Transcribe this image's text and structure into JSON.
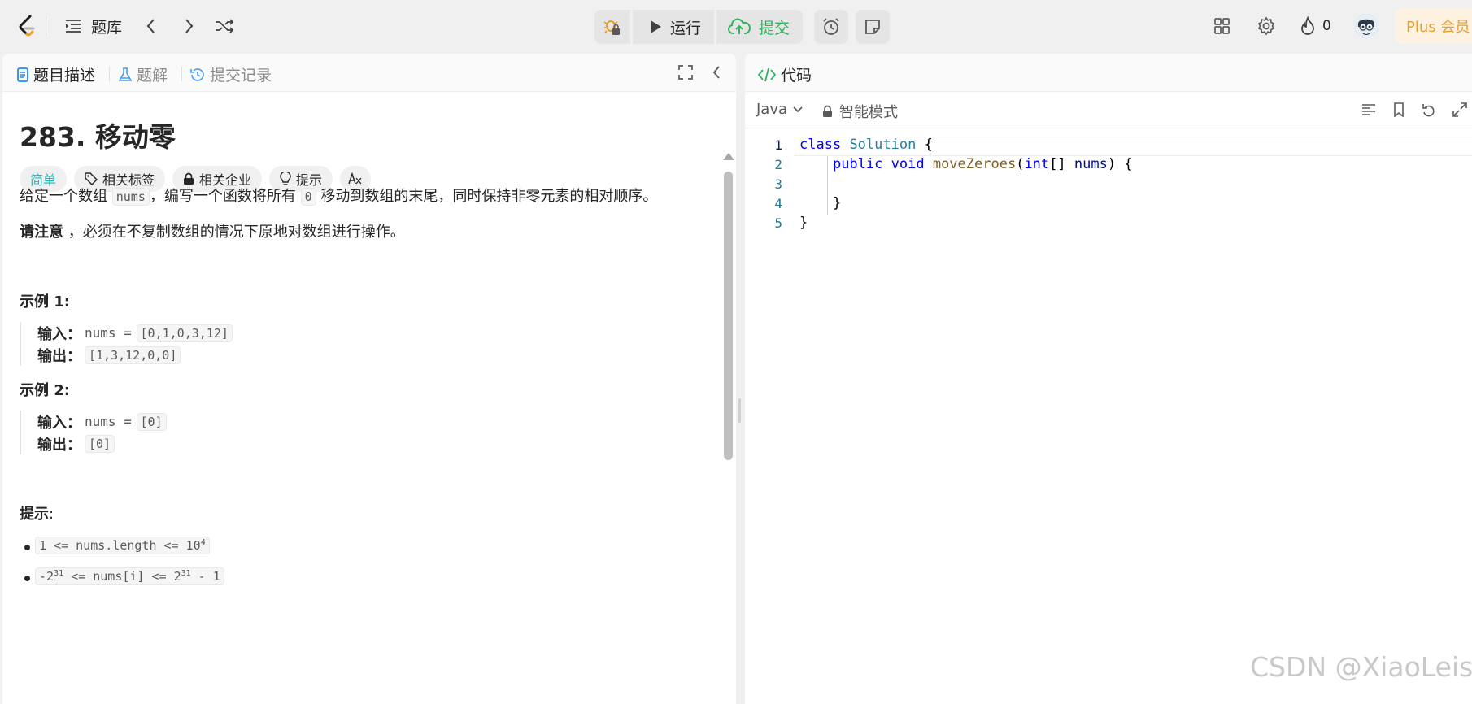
{
  "topbar": {
    "problems_label": "题库",
    "run_label": "运行",
    "submit_label": "提交",
    "streak_count": "0",
    "plus_label": "Plus 会员",
    "colors": {
      "submit": "#2db55d",
      "plus_text": "#e3a030",
      "plus_bg": "#fdf2e2"
    }
  },
  "left": {
    "tabs": [
      "题目描述",
      "题解",
      "提交记录"
    ],
    "title": "283. 移动零",
    "tags": {
      "difficulty": "简单",
      "related_tags": "相关标签",
      "related_companies": "相关企业",
      "hint": "提示"
    },
    "desc": {
      "p1_a": "给定一个数组 ",
      "p1_code1": "nums",
      "p1_b": "，编写一个函数将所有 ",
      "p1_code2": "0",
      "p1_c": " 移动到数组的末尾，同时保持非零元素的相对顺序。",
      "p2_bold": "请注意",
      "p2_rest": " ，必须在不复制数组的情况下原地对数组进行操作。"
    },
    "examples": [
      {
        "title": "示例 1:",
        "input_label": "输入：",
        "input_prefix": "nums = ",
        "input_value": "[0,1,0,3,12]",
        "output_label": "输出：",
        "output_value": "[1,3,12,0,0]"
      },
      {
        "title": "示例 2:",
        "input_label": "输入：",
        "input_prefix": "nums = ",
        "input_value": "[0]",
        "output_label": "输出：",
        "output_value": "[0]"
      }
    ],
    "constraints_title": "提示",
    "constraints_colon": ":",
    "constraint1": {
      "a": "1 <= nums.length <= 10",
      "sup": "4"
    },
    "constraint2": {
      "a": "-2",
      "sup1": "31",
      "b": " <= nums[i] <= 2",
      "sup2": "31",
      "c": " - 1"
    }
  },
  "right": {
    "tab": "代码",
    "language": "Java",
    "mode": "智能模式",
    "line_numbers": [
      "1",
      "2",
      "3",
      "4",
      "5"
    ]
  },
  "code": {
    "l1_kw": "class",
    "l1_ty": "Solution",
    "l1_rest": " {",
    "l2_indent": "    ",
    "l2_kw1": "public",
    "l2_kw2": "void",
    "l2_fn": "moveZeroes",
    "l2_p1": "(",
    "l2_ty": "int",
    "l2_p2": "[] ",
    "l2_param": "nums",
    "l2_rest": ") {",
    "l4": "    }",
    "l5": "}"
  },
  "watermark": "CSDN @XiaoLeisj"
}
